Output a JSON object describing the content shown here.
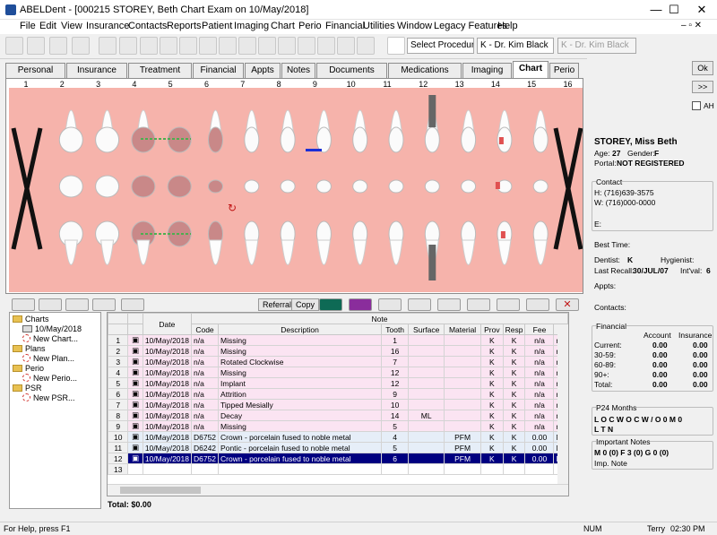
{
  "window": {
    "title": "ABELDent - [000215 STOREY, Beth Chart Exam on 10/May/2018]",
    "min": "—",
    "max": "☐",
    "close": "✕"
  },
  "menu": [
    "File",
    "Edit",
    "View",
    "Insurance",
    "Contacts",
    "Reports",
    "Patient",
    "Imaging",
    "Chart",
    "Perio",
    "Financial",
    "Utilities",
    "Window",
    "Legacy Features",
    "Help"
  ],
  "toolbar": {
    "procedure": "Select Procedure",
    "provider1": "K - Dr. Kim Black",
    "provider2": "K - Dr. Kim Black",
    "cursor_icon": "pointer-arrow-icon"
  },
  "tabs": [
    "Personal",
    "Insurance",
    "Treatment",
    "Financial",
    "Appts",
    "Notes",
    "Documents",
    "Medications",
    "Imaging",
    "Chart",
    "Perio"
  ],
  "active_tab": "Chart",
  "tooth_numbers": [
    "1",
    "2",
    "3",
    "4",
    "5",
    "6",
    "7",
    "8",
    "9",
    "10",
    "11",
    "12",
    "13",
    "14",
    "15",
    "16"
  ],
  "lower_toolbar": {
    "referral": "Referral",
    "copy": "Copy"
  },
  "tree": [
    {
      "label": "Charts",
      "type": "folder"
    },
    {
      "label": "10/May/2018",
      "type": "chart"
    },
    {
      "label": "New Chart...",
      "type": "new"
    },
    {
      "label": "Plans",
      "type": "folder"
    },
    {
      "label": "New Plan...",
      "type": "new"
    },
    {
      "label": "Perio",
      "type": "folder"
    },
    {
      "label": "New Perio...",
      "type": "new"
    },
    {
      "label": "PSR",
      "type": "folder"
    },
    {
      "label": "New PSR...",
      "type": "new"
    }
  ],
  "grid": {
    "top_headers": {
      "date": "Date",
      "note": "Note"
    },
    "headers": [
      "Code",
      "Description",
      "Tooth",
      "Surface",
      "Material",
      "Prov",
      "Resp",
      "Fee",
      "Bi"
    ],
    "rows": [
      {
        "n": "1",
        "date": "10/May/2018",
        "code": "n/a",
        "desc": "Missing",
        "tooth": "1",
        "surf": "",
        "mat": "",
        "prov": "K",
        "resp": "K",
        "fee": "n/a",
        "bi": "n",
        "style": "pink"
      },
      {
        "n": "2",
        "date": "10/May/2018",
        "code": "n/a",
        "desc": "Missing",
        "tooth": "16",
        "surf": "",
        "mat": "",
        "prov": "K",
        "resp": "K",
        "fee": "n/a",
        "bi": "n",
        "style": "pink"
      },
      {
        "n": "3",
        "date": "10/May/2018",
        "code": "n/a",
        "desc": "Rotated Clockwise",
        "tooth": "7",
        "surf": "",
        "mat": "",
        "prov": "K",
        "resp": "K",
        "fee": "n/a",
        "bi": "n",
        "style": "pink"
      },
      {
        "n": "4",
        "date": "10/May/2018",
        "code": "n/a",
        "desc": "Missing",
        "tooth": "12",
        "surf": "",
        "mat": "",
        "prov": "K",
        "resp": "K",
        "fee": "n/a",
        "bi": "n",
        "style": "pink"
      },
      {
        "n": "5",
        "date": "10/May/2018",
        "code": "n/a",
        "desc": "Implant",
        "tooth": "12",
        "surf": "",
        "mat": "",
        "prov": "K",
        "resp": "K",
        "fee": "n/a",
        "bi": "n",
        "style": "pink"
      },
      {
        "n": "6",
        "date": "10/May/2018",
        "code": "n/a",
        "desc": "Attrition",
        "tooth": "9",
        "surf": "",
        "mat": "",
        "prov": "K",
        "resp": "K",
        "fee": "n/a",
        "bi": "n",
        "style": "pink"
      },
      {
        "n": "7",
        "date": "10/May/2018",
        "code": "n/a",
        "desc": "Tipped Mesially",
        "tooth": "10",
        "surf": "",
        "mat": "",
        "prov": "K",
        "resp": "K",
        "fee": "n/a",
        "bi": "n",
        "style": "pink"
      },
      {
        "n": "8",
        "date": "10/May/2018",
        "code": "n/a",
        "desc": "Decay",
        "tooth": "14",
        "surf": "ML",
        "mat": "",
        "prov": "K",
        "resp": "K",
        "fee": "n/a",
        "bi": "n",
        "style": "pink"
      },
      {
        "n": "9",
        "date": "10/May/2018",
        "code": "n/a",
        "desc": "Missing",
        "tooth": "5",
        "surf": "",
        "mat": "",
        "prov": "K",
        "resp": "K",
        "fee": "n/a",
        "bi": "n",
        "style": "pink"
      },
      {
        "n": "10",
        "date": "10/May/2018",
        "code": "D6752",
        "desc": "Crown - porcelain fused to noble metal",
        "tooth": "4",
        "surf": "",
        "mat": "PFM",
        "prov": "K",
        "resp": "K",
        "fee": "0.00",
        "bi": "N",
        "style": "blue"
      },
      {
        "n": "11",
        "date": "10/May/2018",
        "code": "D6242",
        "desc": "Pontic - porcelain fused to noble metal",
        "tooth": "5",
        "surf": "",
        "mat": "PFM",
        "prov": "K",
        "resp": "K",
        "fee": "0.00",
        "bi": "N",
        "style": "blue"
      },
      {
        "n": "12",
        "date": "10/May/2018",
        "code": "D6752",
        "desc": "Crown - porcelain fused to noble metal",
        "tooth": "6",
        "surf": "",
        "mat": "PFM",
        "prov": "K",
        "resp": "K",
        "fee": "0.00",
        "bi": "N",
        "style": "sel"
      }
    ],
    "empty_row": "13"
  },
  "total": "Total: $0.00",
  "right": {
    "ok": "Ok",
    "nav": ">>",
    "ah": "AH",
    "name": "STOREY, Miss Beth",
    "age_label": "Age:",
    "age": "27",
    "gender_label": "Gender:",
    "gender": "F",
    "portal_label": "Portal:",
    "portal": "NOT REGISTERED",
    "contact_label": "Contact",
    "h": "H:  (716)639-3575",
    "w": "W:  (716)000-0000",
    "e": "E:",
    "best_time": "Best Time:",
    "dentist_label": "Dentist:",
    "dentist": "K",
    "hyg_label": "Hygienist:",
    "recall_label": "Last Recall:",
    "recall": "30/JUL/07",
    "intval_label": "Int'val:",
    "intval": "6",
    "appts": "Appts:",
    "contacts": "Contacts:",
    "fin_label": "Financial",
    "acct": "Account",
    "ins": "Insurance",
    "fin_rows": [
      [
        "Current:",
        "0.00",
        "0.00"
      ],
      [
        "30-59:",
        "0.00",
        "0.00"
      ],
      [
        "60-89:",
        "0.00",
        "0.00"
      ],
      [
        "90+:",
        "0.00",
        "0.00"
      ],
      [
        "Total:",
        "0.00",
        "0.00"
      ]
    ],
    "p24": "P24 Months",
    "p24_line1": "L O  C W  O        C W / O  0         M  0",
    "p24_line2": "L T  N",
    "notes_label": "Important Notes",
    "notes_line": "M  0    (0)   F  3    (0)    G  0    (0)",
    "imp_note": "Imp. Note"
  },
  "status": {
    "help": "For Help, press F1",
    "num": "NUM",
    "user": "Terry",
    "time": "02:30 PM"
  },
  "colors": {
    "chart_bg": "#f6b3ab",
    "selected_row": "#000080",
    "treatment_row": "#e6eef8",
    "condition_row": "#fbe4f2"
  }
}
